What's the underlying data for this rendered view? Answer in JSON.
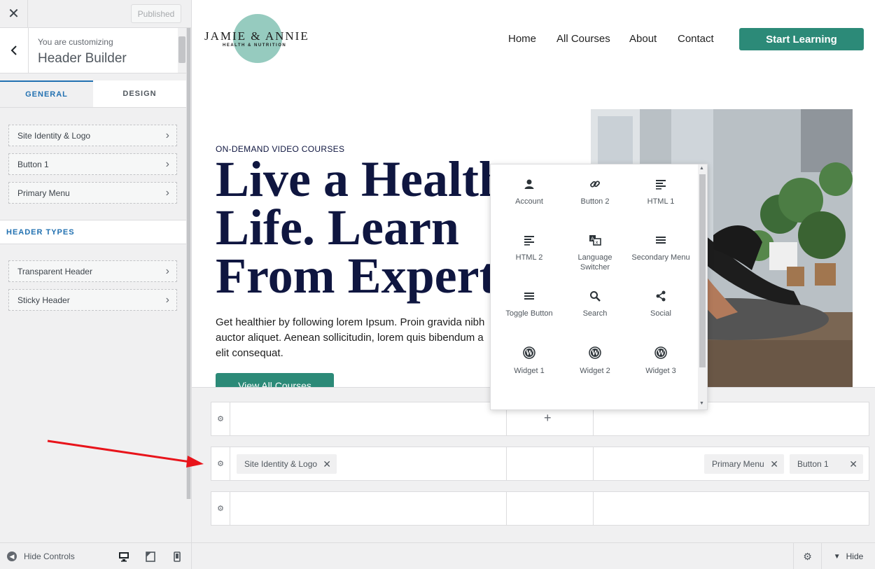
{
  "sidebar": {
    "published_label": "Published",
    "customizing_small": "You are customizing",
    "customizing_title": "Header Builder",
    "tabs": [
      {
        "label": "GENERAL"
      },
      {
        "label": "DESIGN"
      }
    ],
    "general_items": [
      {
        "label": "Site Identity & Logo"
      },
      {
        "label": "Button 1"
      },
      {
        "label": "Primary Menu"
      }
    ],
    "section_title": "HEADER TYPES",
    "header_type_items": [
      {
        "label": "Transparent Header"
      },
      {
        "label": "Sticky Header"
      }
    ],
    "hide_controls_label": "Hide Controls"
  },
  "preview": {
    "logo": {
      "name": "JAMIE & ANNIE",
      "tagline": "HEALTH & NUTRITION"
    },
    "nav": [
      {
        "label": "Home"
      },
      {
        "label": "All Courses"
      },
      {
        "label": "About"
      },
      {
        "label": "Contact"
      }
    ],
    "cta_label": "Start Learning",
    "hero": {
      "eyebrow": "ON-DEMAND VIDEO COURSES",
      "title_lines": [
        "Live a Health",
        "Life. Learn",
        "From Expert"
      ],
      "para_lines": [
        "Get healthier by following lorem Ipsum. Proin gravida nibh",
        "auctor aliquet. Aenean sollicitudin, lorem quis bibendum a",
        "elit consequat."
      ],
      "button_label": "View All Courses"
    }
  },
  "popup": {
    "items": [
      {
        "label": "Account",
        "icon": "account-icon"
      },
      {
        "label": "Button 2",
        "icon": "link-icon"
      },
      {
        "label": "HTML 1",
        "icon": "html-icon"
      },
      {
        "label": "HTML 2",
        "icon": "html-icon"
      },
      {
        "label": "Language Switcher",
        "icon": "translate-icon"
      },
      {
        "label": "Secondary Menu",
        "icon": "menu-icon"
      },
      {
        "label": "Toggle Button",
        "icon": "menu-icon"
      },
      {
        "label": "Search",
        "icon": "search-icon"
      },
      {
        "label": "Social",
        "icon": "share-icon"
      },
      {
        "label": "Widget 1",
        "icon": "wordpress-icon"
      },
      {
        "label": "Widget 2",
        "icon": "wordpress-icon"
      },
      {
        "label": "Widget 3",
        "icon": "wordpress-icon"
      }
    ]
  },
  "builder": {
    "main_row_chips": [
      {
        "label": "Site Identity & Logo"
      },
      {
        "label": "Primary Menu"
      },
      {
        "label": "Button 1"
      }
    ]
  },
  "bottombar": {
    "hide_label": "Hide"
  },
  "colors": {
    "accent": "#2c8a78",
    "wp_blue": "#2271b1",
    "hero_text": "#0f1640",
    "logo_circle": "#96cbbf",
    "annotation_arrow": "#e8141b"
  }
}
